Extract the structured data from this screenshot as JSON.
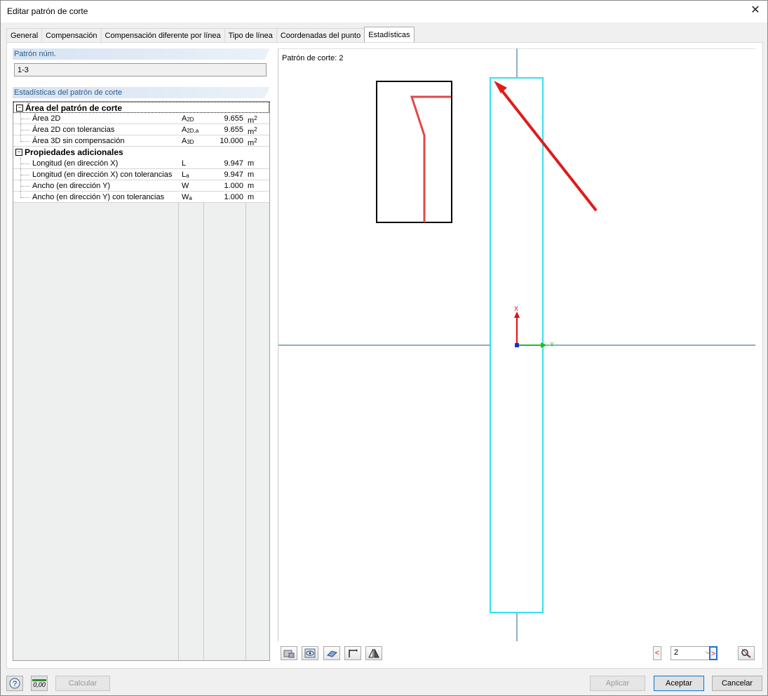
{
  "window": {
    "title": "Editar patrón de corte",
    "close_glyph": "✕"
  },
  "tabs": [
    {
      "label": "General"
    },
    {
      "label": "Compensación"
    },
    {
      "label": "Compensación diferente por línea"
    },
    {
      "label": "Tipo de línea"
    },
    {
      "label": "Coordenadas del punto"
    },
    {
      "label": "Estadísticas",
      "active": true
    }
  ],
  "pattern_no": {
    "header": "Patrón núm.",
    "value": "1-3"
  },
  "stats": {
    "header": "Estadísticas del patrón de corte",
    "groups": [
      {
        "title": "Área del patrón de corte",
        "toggle": "−",
        "rows": [
          {
            "label": "Área 2D",
            "sym": "A",
            "sym_sub": "2D",
            "value": "9.655",
            "unit": "m",
            "unit_sup": "2"
          },
          {
            "label": "Área 2D con tolerancias",
            "sym": "A",
            "sym_sub": "2D,a",
            "value": "9.655",
            "unit": "m",
            "unit_sup": "2"
          },
          {
            "label": "Área 3D sin compensación",
            "sym": "A",
            "sym_sub": "3D",
            "value": "10.000",
            "unit": "m",
            "unit_sup": "2"
          }
        ]
      },
      {
        "title": "Propiedades adicionales",
        "toggle": "−",
        "rows": [
          {
            "label": "Longitud (en dirección X)",
            "sym": "L",
            "sym_sub": "",
            "value": "9.947",
            "unit": "m",
            "unit_sup": ""
          },
          {
            "label": "Longitud (en dirección X) con tolerancias",
            "sym": "L",
            "sym_sub": "a",
            "value": "9.947",
            "unit": "m",
            "unit_sup": ""
          },
          {
            "label": "Ancho (en dirección Y)",
            "sym": "W",
            "sym_sub": "",
            "value": "1.000",
            "unit": "m",
            "unit_sup": ""
          },
          {
            "label": "Ancho (en dirección Y) con tolerancias",
            "sym": "W",
            "sym_sub": "a",
            "value": "1.000",
            "unit": "m",
            "unit_sup": ""
          }
        ]
      }
    ]
  },
  "viewport": {
    "label": "Patrón de corte: 2",
    "axis_x": "X",
    "axis_y": "Y",
    "colors": {
      "axis_line": "#1f5f7a",
      "pattern_outline": "#35e0ee",
      "arrow": "#e11a1a",
      "detail_line": "#e04a4a"
    }
  },
  "nav": {
    "prev": "<",
    "next": ">",
    "selected": "2"
  },
  "buttons": {
    "calculate": "Calcular",
    "apply": "Aplicar",
    "ok": "Aceptar",
    "cancel": "Cancelar",
    "units_label": "0,00"
  }
}
